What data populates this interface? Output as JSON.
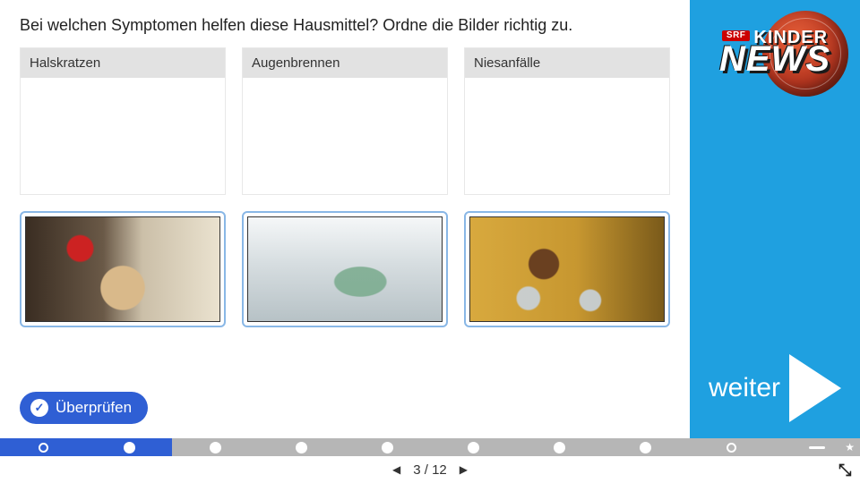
{
  "question": "Bei welchen Symptomen helfen diese Hausmittel? Ordne die Bilder richtig zu.",
  "drop_slots": [
    {
      "label": "Halskratzen"
    },
    {
      "label": "Augenbrennen"
    },
    {
      "label": "Niesanfälle"
    }
  ],
  "drag_items": [
    {
      "alt": "Person legt Gurkenscheiben auf Augen"
    },
    {
      "alt": "Wasser läuft in Glas mit Kräutern"
    },
    {
      "alt": "Honig wird in Gläser gegossen"
    }
  ],
  "check_button": {
    "label": "Überprüfen"
  },
  "logo": {
    "badge": "SRF",
    "line1": "KINDER",
    "line2": "NEWS"
  },
  "next": {
    "label": "weiter"
  },
  "progress": {
    "segments": [
      {
        "state": "active",
        "marker": "ring"
      },
      {
        "state": "active",
        "marker": "solid"
      },
      {
        "state": "pending",
        "marker": "solid"
      },
      {
        "state": "pending",
        "marker": "solid"
      },
      {
        "state": "pending",
        "marker": "solid"
      },
      {
        "state": "pending",
        "marker": "solid"
      },
      {
        "state": "pending",
        "marker": "solid"
      },
      {
        "state": "pending",
        "marker": "solid"
      },
      {
        "state": "pending",
        "marker": "ring"
      },
      {
        "state": "pending",
        "marker": "star"
      }
    ]
  },
  "pager": {
    "current": 3,
    "total": 12,
    "separator": " / "
  }
}
